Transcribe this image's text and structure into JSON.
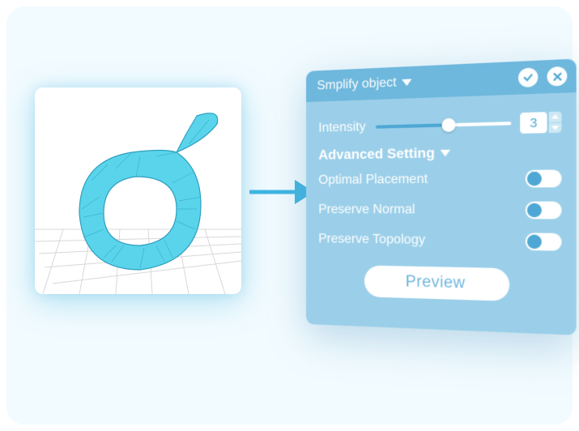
{
  "panel": {
    "title": "Smplify object",
    "intensity_label": "Intensity",
    "intensity_value": "3",
    "section_label": "Advanced Setting",
    "opt_placement": "Optimal Placement",
    "preserve_normal": "Preserve  Normal",
    "preserve_topology": "Preserve  Topology",
    "preview_label": "Preview"
  }
}
